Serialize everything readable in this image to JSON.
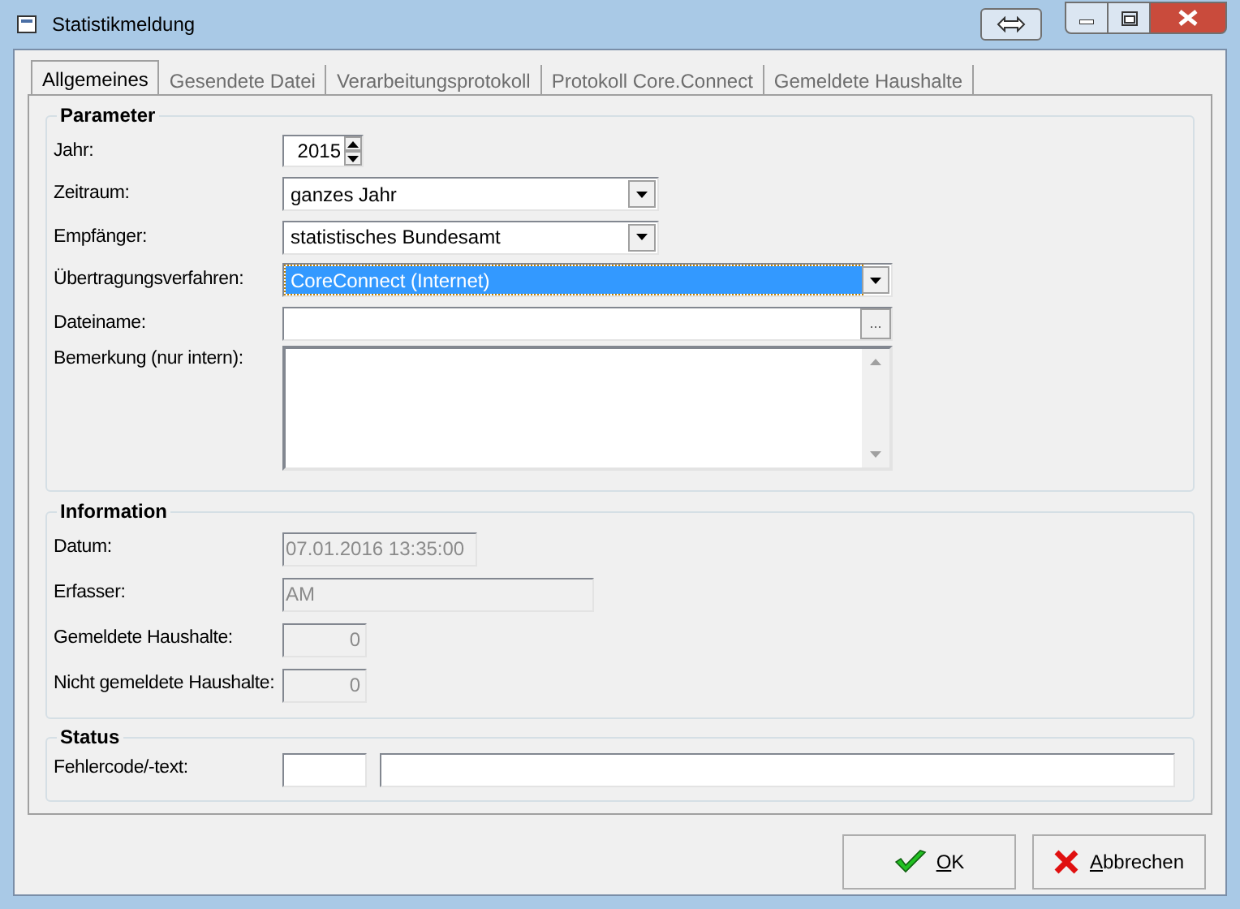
{
  "window": {
    "title": "Statistikmeldung"
  },
  "tabs": [
    {
      "label": "Allgemeines",
      "selected": true
    },
    {
      "label": "Gesendete Datei",
      "selected": false
    },
    {
      "label": "Verarbeitungsprotokoll",
      "selected": false
    },
    {
      "label": "Protokoll Core.Connect",
      "selected": false
    },
    {
      "label": "Gemeldete Haushalte",
      "selected": false
    }
  ],
  "parameter": {
    "title": "Parameter",
    "fields": [
      {
        "label": "Jahr:",
        "kind": "spinner",
        "value": "2015"
      },
      {
        "label": "Zeitraum:",
        "kind": "dropdown",
        "value": "ganzes Jahr",
        "focused": false
      },
      {
        "label": "Empfänger:",
        "kind": "dropdown",
        "value": "statistisches Bundesamt",
        "focused": false
      },
      {
        "label": "Übertragungsverfahren:",
        "kind": "dropdown-wide",
        "value": "CoreConnect (Internet)",
        "focused": true
      },
      {
        "label": "Dateiname:",
        "kind": "file",
        "button": "..."
      },
      {
        "label": "Bemerkung (nur intern):",
        "kind": "memo"
      }
    ]
  },
  "information": {
    "title": "Information",
    "fields": [
      {
        "label": "Datum:",
        "kind": "date",
        "value": "07.01.2016 13:35:00",
        "disabled": true
      },
      {
        "label": "Erfasser:",
        "kind": "text",
        "value": "AM",
        "disabled": true
      },
      {
        "label": "Gemeldete Haushalte:",
        "kind": "number",
        "value": "0",
        "disabled": true
      },
      {
        "label": "Nicht gemeldete Haushalte:",
        "kind": "number",
        "value": "0",
        "disabled": true
      }
    ]
  },
  "status": {
    "title": "Status",
    "label": "Fehlercode/-text:"
  },
  "buttons": [
    {
      "label": "OK",
      "kind": "ok"
    },
    {
      "label": "Abbrechen",
      "kind": "cancel"
    }
  ]
}
